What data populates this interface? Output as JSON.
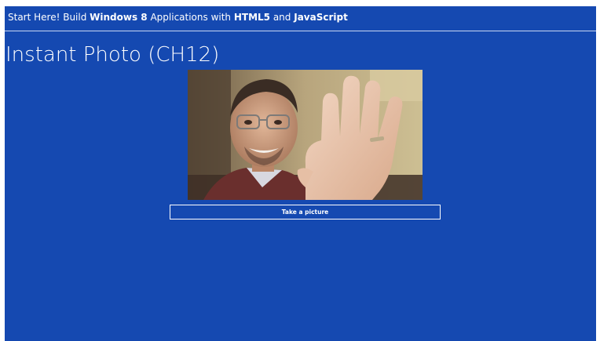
{
  "header": {
    "parts": [
      {
        "text": "Start Here! Build ",
        "bold": false
      },
      {
        "text": "Windows 8",
        "bold": true
      },
      {
        "text": " Applications with ",
        "bold": false
      },
      {
        "text": "HTML5",
        "bold": true
      },
      {
        "text": " and ",
        "bold": false
      },
      {
        "text": "JavaScript",
        "bold": true
      }
    ]
  },
  "page": {
    "title": "Instant Photo (CH12)"
  },
  "camera": {
    "button_label": "Take a picture"
  },
  "colors": {
    "background": "#1549b1",
    "text": "#ffffff"
  }
}
